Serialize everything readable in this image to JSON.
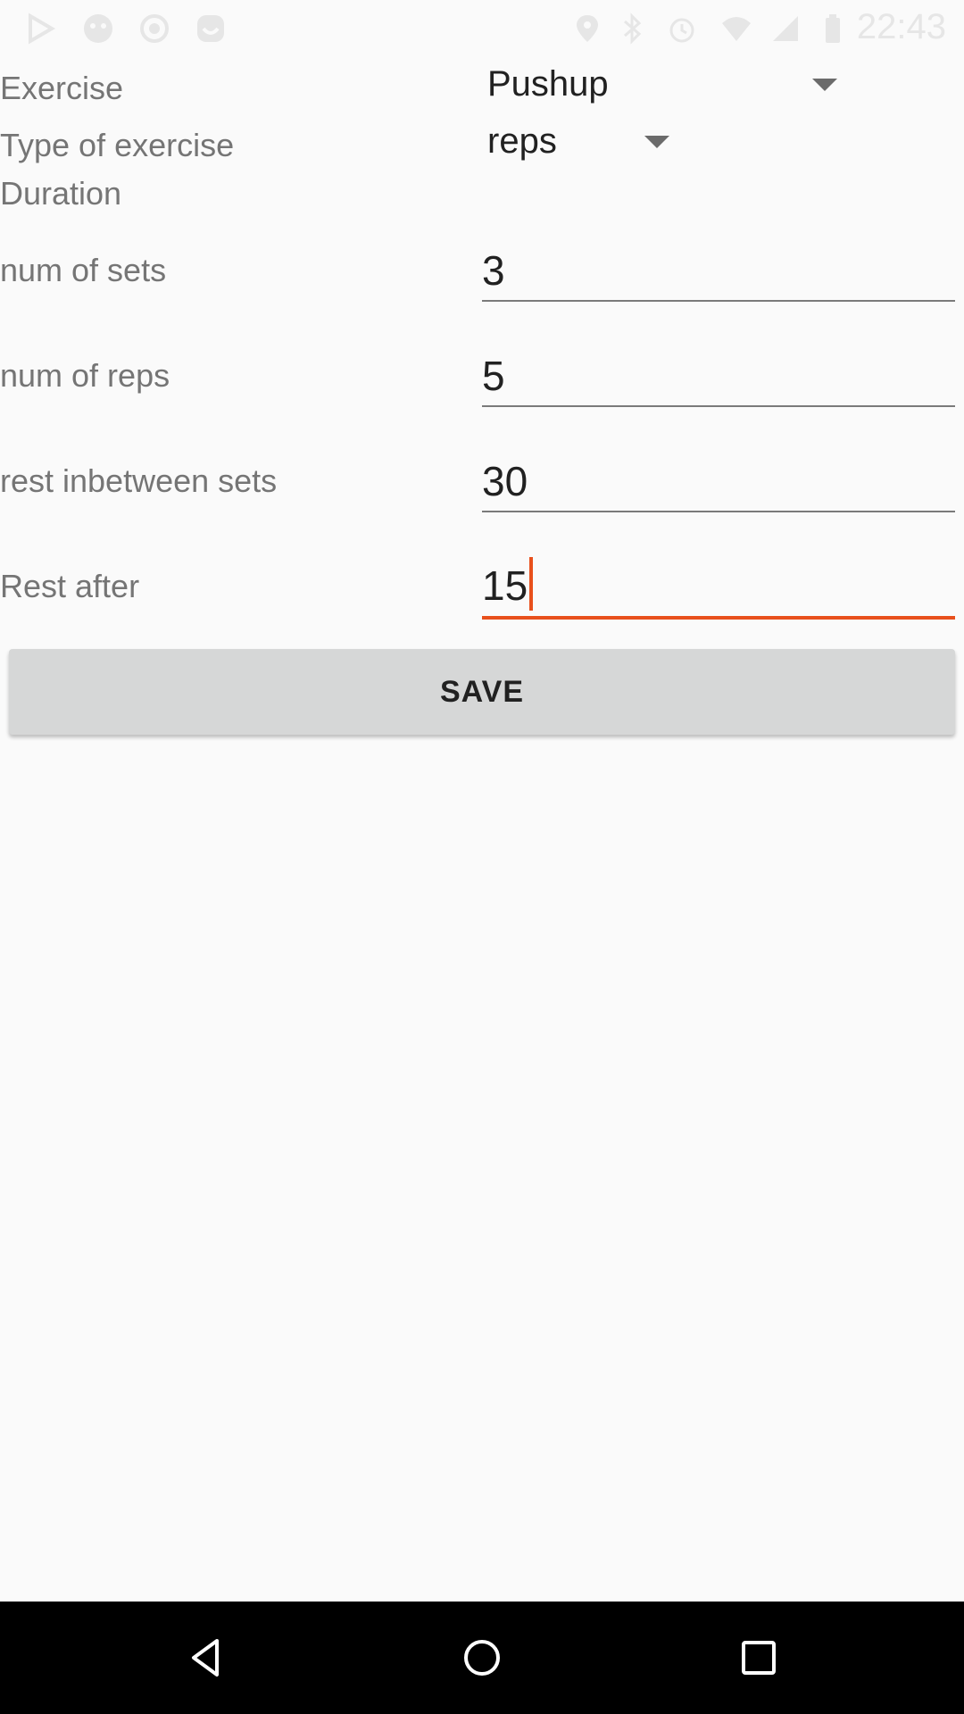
{
  "status_bar": {
    "time": "22:43",
    "left_icons": [
      "play-store-icon",
      "notification-icon",
      "record-icon",
      "app-notification-icon"
    ],
    "right_icons": [
      "location-icon",
      "bluetooth-icon",
      "alarm-icon",
      "wifi-icon",
      "signal-icon",
      "battery-icon"
    ]
  },
  "form": {
    "exercise": {
      "label": "Exercise",
      "value": "Pushup"
    },
    "type_of_exercise": {
      "label": "Type of exercise",
      "value": "reps"
    },
    "duration": {
      "label": "Duration"
    },
    "num_of_sets": {
      "label": "num of sets",
      "value": "3"
    },
    "num_of_reps": {
      "label": "num of reps",
      "value": "5"
    },
    "rest_inbetween_sets": {
      "label": "rest inbetween sets",
      "value": "30"
    },
    "rest_after": {
      "label": "Rest after",
      "value": "15"
    }
  },
  "save_button": {
    "label": "SAVE"
  },
  "colors": {
    "accent": "#e8501c",
    "background": "#fafafa",
    "button": "#d6d7d7",
    "label": "#757575",
    "nav_bar": "#000000"
  },
  "nav_bar": {
    "buttons": [
      "back-icon",
      "home-icon",
      "recents-icon"
    ]
  }
}
